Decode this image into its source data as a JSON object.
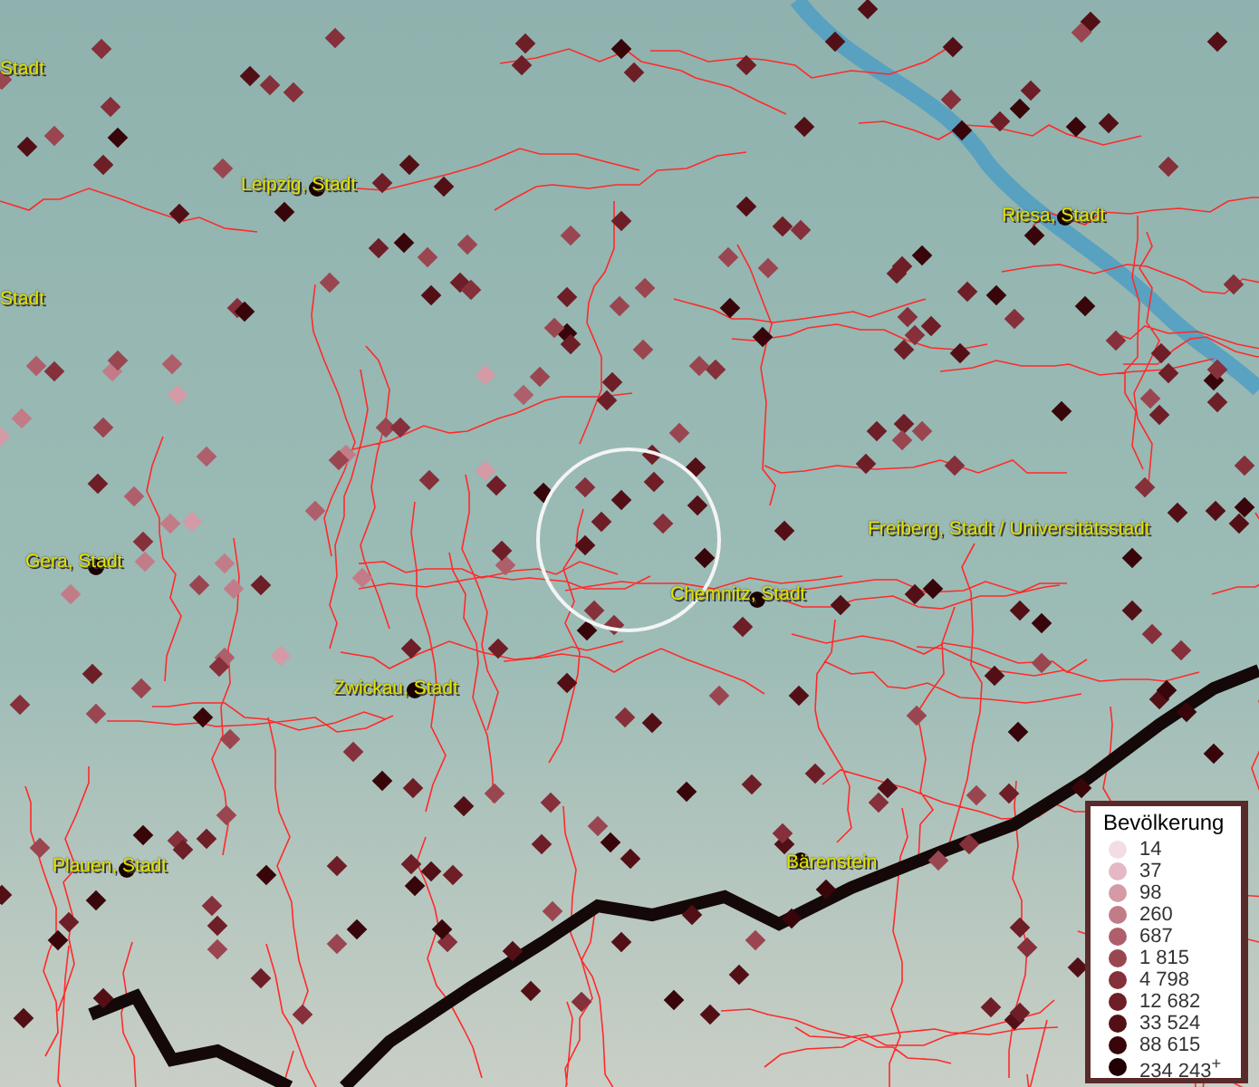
{
  "map": {
    "place_labels": [
      {
        "text": "Stadt"
      },
      {
        "text": "Leipzig, Stadt"
      },
      {
        "text": "Stadt"
      },
      {
        "text": "Riesa, Stadt"
      },
      {
        "text": "Freiberg, Stadt / Universitätsstadt"
      },
      {
        "text": "Gera, Stadt"
      },
      {
        "text": "Chemnitz, Stadt"
      },
      {
        "text": "Zwickau, Stadt"
      },
      {
        "text": "Plauen, Stadt"
      },
      {
        "text": "Bärenstein"
      }
    ]
  },
  "legend": {
    "title": "Bevölkerung",
    "items": [
      {
        "value": "14",
        "color": "#f4dce6"
      },
      {
        "value": "37",
        "color": "#e4b8c4"
      },
      {
        "value": "98",
        "color": "#d49aa6"
      },
      {
        "value": "260",
        "color": "#c27c88"
      },
      {
        "value": "687",
        "color": "#ae5f6b"
      },
      {
        "value": "1 815",
        "color": "#9a4650"
      },
      {
        "value": "4 798",
        "color": "#85303a"
      },
      {
        "value": "12 682",
        "color": "#6e1e26"
      },
      {
        "value": "33 524",
        "color": "#521016"
      },
      {
        "value": "88 615",
        "color": "#38060a"
      },
      {
        "value": "234 243$^{+}$",
        "color": "#200002"
      }
    ]
  }
}
